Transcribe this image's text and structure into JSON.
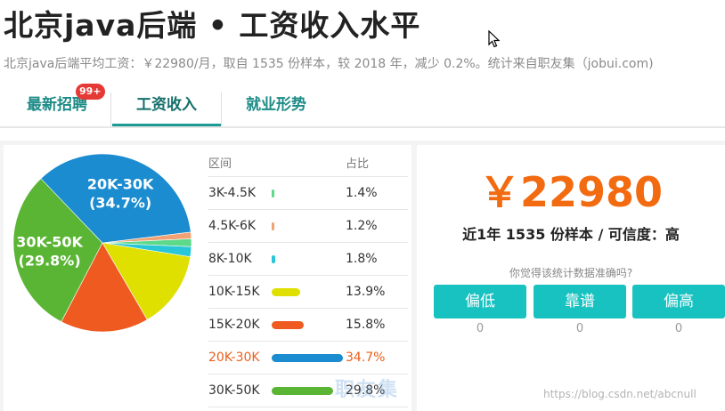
{
  "header": {
    "title": "北京java后端 • 工资收入水平",
    "summary": "北京java后端平均工资：￥22980/月，取自 1535 份样本，较 2018 年，减少 0.2%。统计来自职友集（jobui.com)"
  },
  "tabs": [
    {
      "label": "最新招聘",
      "badge": "99+"
    },
    {
      "label": "工资收入",
      "active": true
    },
    {
      "label": "就业形势"
    }
  ],
  "table": {
    "col_range": "区间",
    "col_pct": "占比"
  },
  "chart_data": {
    "type": "pie",
    "categories": [
      "3K-4.5K",
      "4.5K-6K",
      "8K-10K",
      "10K-15K",
      "15K-20K",
      "20K-30K",
      "30K-50K"
    ],
    "values": [
      1.4,
      1.2,
      1.8,
      13.9,
      15.8,
      34.7,
      29.8
    ],
    "value_labels": [
      "1.4%",
      "1.2%",
      "1.8%",
      "13.9%",
      "15.8%",
      "34.7%",
      "29.8%"
    ],
    "colors": [
      "#5dd98a",
      "#f0a275",
      "#28c6d6",
      "#dfe000",
      "#ee5a1f",
      "#1b8ccf",
      "#5bb534"
    ],
    "slice_labels": [
      {
        "category": "20K-30K",
        "line1": "20K-30K",
        "line2": "(34.7%)"
      },
      {
        "category": "30K-50K",
        "line1": "30K-50K",
        "line2": "(29.8%)"
      }
    ],
    "highlighted": "20K-30K"
  },
  "stats": {
    "salary": "￥22980",
    "credibility": "近1年 1535 份样本 / 可信度：高",
    "question": "你觉得该统计数据准确吗?"
  },
  "votes": [
    {
      "label": "偏低",
      "count": "0"
    },
    {
      "label": "靠谱",
      "count": "0"
    },
    {
      "label": "偏高",
      "count": "0"
    }
  ],
  "watermarks": {
    "brand": "职友集",
    "url": "https://blog.csdn.net/abcnull"
  }
}
